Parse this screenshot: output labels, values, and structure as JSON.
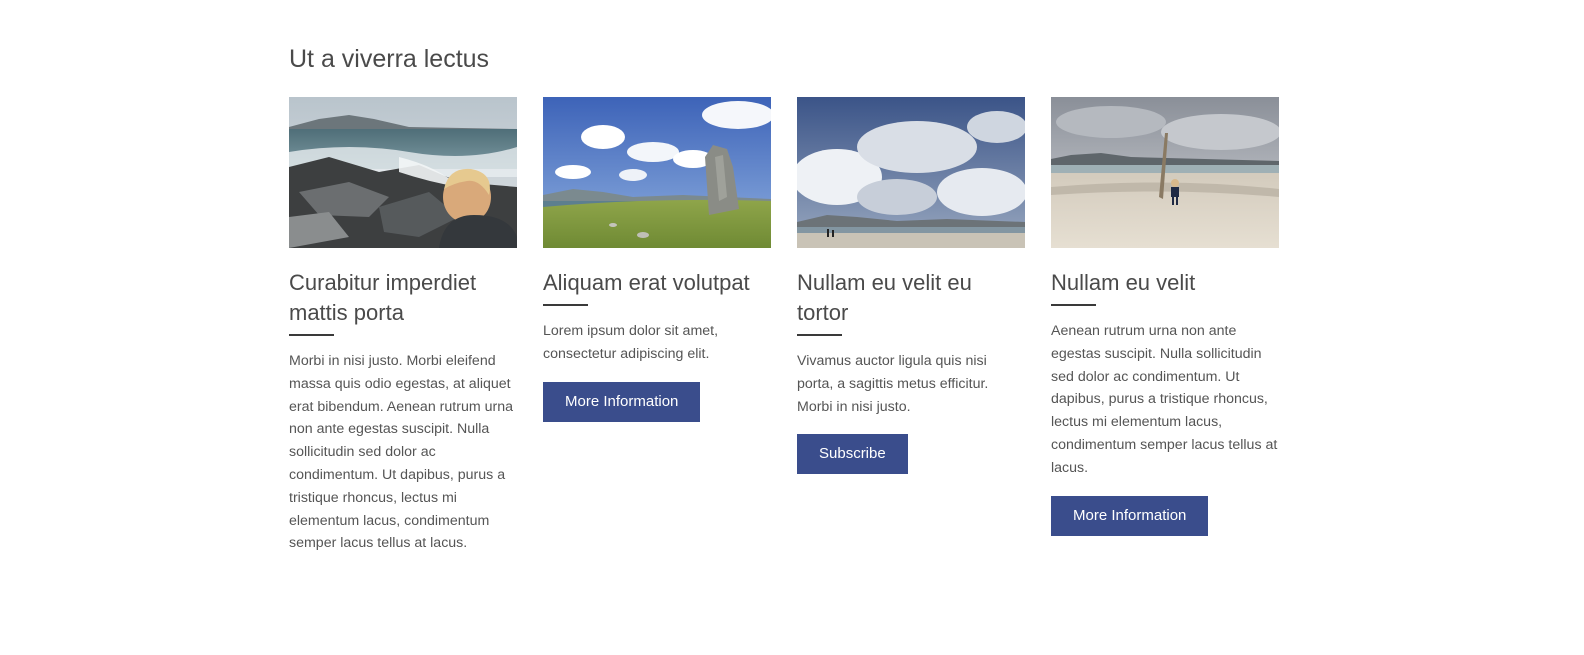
{
  "section": {
    "title": "Ut a viverra lectus"
  },
  "cards": [
    {
      "image_alt": "Child looking at waves crashing on rocky shore",
      "title": "Curabitur imperdiet mattis porta",
      "text": "Morbi in nisi justo. Morbi eleifend massa quis odio egestas, at aliquet erat bibendum. Aenean rutrum urna non ante egestas suscipit. Nulla sollicitudin sed dolor ac condimentum. Ut dapibus, purus a tristique rhoncus, lectus mi elementum lacus, condimentum semper lacus tellus at lacus.",
      "button": ""
    },
    {
      "image_alt": "Standing stone on green field under blue sky",
      "title": "Aliquam erat volutpat",
      "text": "Lorem ipsum dolor sit amet, consectetur adipiscing elit.",
      "button": "More Information"
    },
    {
      "image_alt": "Cloudy sky over beach with people walking",
      "title": "Nullam eu velit eu tortor",
      "text": "Vivamus auctor ligula quis nisi porta, a sagittis metus efficitur. Morbi in nisi justo.",
      "button": "Subscribe"
    },
    {
      "image_alt": "Child walking on sandy beach near wooden post",
      "title": "Nullam eu velit",
      "text": "Aenean rutrum urna non ante egestas suscipit. Nulla sollicitudin sed dolor ac condimentum. Ut dapibus, purus a tristique rhoncus, lectus mi elementum lacus, condimentum semper lacus tellus at lacus.",
      "button": "More Information"
    }
  ],
  "colors": {
    "button_bg": "#3a4d8c",
    "button_text": "#ffffff",
    "heading": "#4a4a4a",
    "body_text": "#555555"
  }
}
